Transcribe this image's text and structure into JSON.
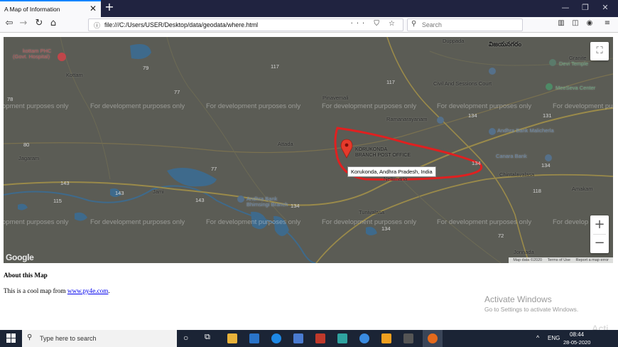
{
  "browser": {
    "tab_title": "A Map of Information",
    "url": "file:///C:/Users/USER/Desktop/data/geodata/where.html",
    "search_placeholder": "Search",
    "new_tab": "+",
    "tab_close": "✕"
  },
  "map": {
    "watermark": "For development purposes only",
    "watermark_partial_left": "opment purposes only",
    "watermark_partial_right_1": "For development pu",
    "watermark_partial_right_2": "For develop",
    "marker_place": "KORUKONDA BRANCH POST OFFICE",
    "marker_place_line1": "KORUKONDA",
    "marker_place_line2": "BRANCH POST OFFICE",
    "info_popup": "Korukonda, Andhra Pradesh, India",
    "labels": {
      "kottam_phc_1": "kottam PHC",
      "kottam_phc_2": "(Govt. Hospital)",
      "kottam": "Kottam",
      "vizianagaram_top": "Vizianagaram",
      "vizianagaram_main": "విజయనగరం",
      "duppada": "Duppada",
      "devi_temple_1": "Granite",
      "devi_temple_2": "Devi Temple",
      "civil_court": "Civil And Sessions Court",
      "meeseva": "MeeSeva Center",
      "pinavemali": "Pinavemali",
      "ramanarayanam": "Ramanarayanam",
      "andhra_bank_malicherla": "Andhra Bank Malicherla",
      "attada": "Attada",
      "jagaram": "Jagaram",
      "canara_bank": "Canara Bank",
      "chintalavalasa": "Chintalavalasa",
      "nellimarla": "Nellimarla",
      "amakam": "Amakam",
      "jami": "Jami",
      "andhra_bank_bhimsingi_1": "Andhra Bank",
      "andhra_bank_bhimsingi_2": "Bhimsingi Branch",
      "tunivalasa": "Tunivalasa",
      "jonnada": "Jonnada"
    },
    "road_numbers": [
      "79",
      "117",
      "77",
      "117",
      "134",
      "131",
      "134",
      "80",
      "78",
      "77",
      "143",
      "143",
      "115",
      "143",
      "134",
      "134",
      "134",
      "118",
      "72"
    ],
    "attribution": {
      "map_data": "Map data ©2020",
      "terms": "Terms of Use",
      "report": "Report a map error"
    },
    "google_logo": "Google",
    "fullscreen_icon": "fullscreen-icon",
    "zoom_in": "+",
    "zoom_out": "−"
  },
  "page": {
    "about_title": "About this Map",
    "about_text_prefix": "This is a cool map from ",
    "about_link": "www.py4e.com",
    "about_text_suffix": "."
  },
  "activation": {
    "line1": "Activate Windows",
    "line2": "Go to Settings to activate Windows."
  },
  "taskbar": {
    "search_placeholder": "Type here to search",
    "language": "ENG",
    "time": "08:44",
    "date": "28-05-2020",
    "watermark": "Acti"
  },
  "colors": {
    "titlebar": "#202340",
    "map_bg": "#5b5c55",
    "highlight_ring": "#e02020",
    "link": "#0000ee",
    "taskbar": "#1b2435"
  }
}
